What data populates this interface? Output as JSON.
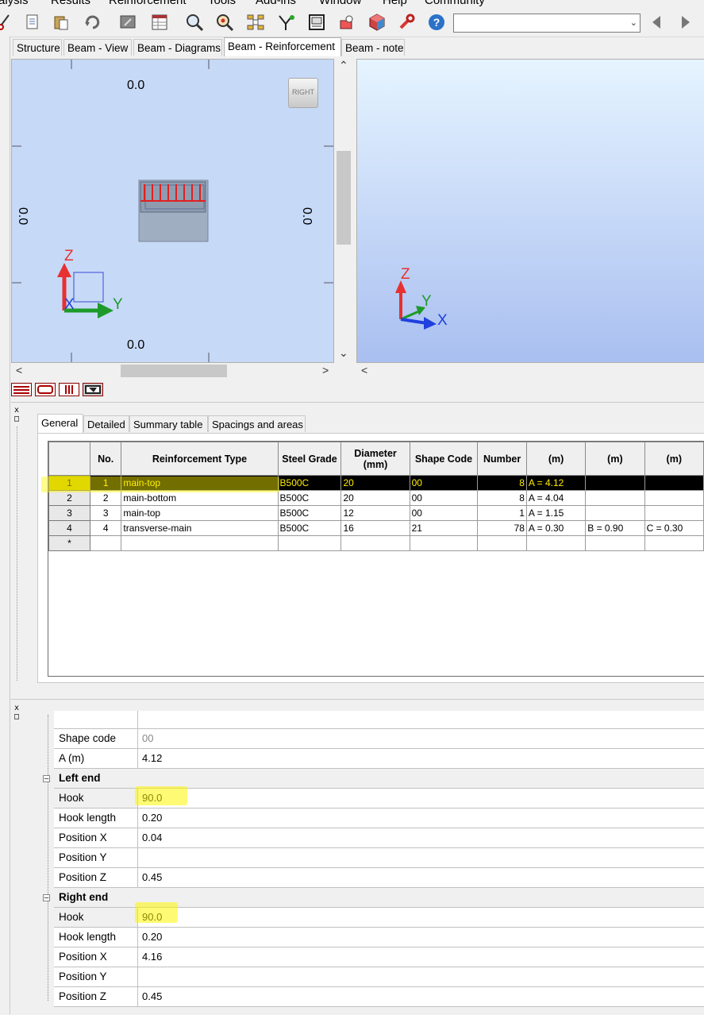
{
  "menu": [
    "alysis",
    "Results",
    "Reinforcement",
    "Tools",
    "Add-ins",
    "Window",
    "Help",
    "Community"
  ],
  "toolbar": {
    "icons": [
      "cut-icon",
      "paste-document-icon",
      "paste-icon",
      "undo-icon",
      "monitor-icon",
      "spreadsheet-icon",
      "zoom-icon",
      "zoom-target-icon",
      "network-icon",
      "tree-icon",
      "table-frame-icon",
      "object-icon",
      "cube-icon",
      "wrench-icon",
      "help-icon"
    ],
    "combo_value": ""
  },
  "tabs": [
    "Structure",
    "Beam - View",
    "Beam - Diagrams",
    "Beam - Reinforcement",
    "Beam - note"
  ],
  "active_tab": "Beam - Reinforcement",
  "viewport_left": {
    "top_value": "0.0",
    "bottom_value": "0.0",
    "left_value": "0.0",
    "right_value": "0.0",
    "view_cube_label": "RIGHT",
    "axes": {
      "z": "Z",
      "y": "Y",
      "x": "X"
    }
  },
  "viewport_right": {
    "axes": {
      "z": "Z",
      "y": "Y",
      "x": "X"
    }
  },
  "sub_tabs": [
    "General",
    "Detailed",
    "Summary table",
    "Spacings and areas"
  ],
  "active_sub_tab": "General",
  "grid": {
    "headers": [
      "No.",
      "Reinforcement Type",
      "Steel Grade",
      "Diameter (mm)",
      "Shape Code",
      "Number",
      "(m)",
      "(m)",
      "(m)"
    ],
    "rows": [
      {
        "row_header": "1",
        "no": "1",
        "type": "main-top",
        "grade": "B500C",
        "diameter": "20",
        "shape": "00",
        "number": "8",
        "m1": "A = 4.12",
        "m2": "",
        "m3": ""
      },
      {
        "row_header": "2",
        "no": "2",
        "type": "main-bottom",
        "grade": "B500C",
        "diameter": "20",
        "shape": "00",
        "number": "8",
        "m1": "A = 4.04",
        "m2": "",
        "m3": ""
      },
      {
        "row_header": "3",
        "no": "3",
        "type": "main-top",
        "grade": "B500C",
        "diameter": "12",
        "shape": "00",
        "number": "1",
        "m1": "A = 1.15",
        "m2": "",
        "m3": ""
      },
      {
        "row_header": "4",
        "no": "4",
        "type": "transverse-main",
        "grade": "B500C",
        "diameter": "16",
        "shape": "21",
        "number": "78",
        "m1": "A = 0.30",
        "m2": "B = 0.90",
        "m3": "C = 0.30"
      }
    ],
    "new_row_marker": "*",
    "selected_row": 1
  },
  "properties": {
    "shape_code_label": "Shape code",
    "shape_code_value": "00",
    "a_label": "A (m)",
    "a_value": "4.12",
    "left_end": {
      "title": "Left end",
      "hook_label": "Hook",
      "hook_value": "90.0",
      "hook_length_label": "Hook length",
      "hook_length_value": "0.20",
      "pos_x_label": "Position X",
      "pos_x_value": "0.04",
      "pos_y_label": "Position Y",
      "pos_y_value": "",
      "pos_z_label": "Position Z",
      "pos_z_value": "0.45"
    },
    "right_end": {
      "title": "Right end",
      "hook_label": "Hook",
      "hook_value": "90.0",
      "hook_length_label": "Hook length",
      "hook_length_value": "0.20",
      "pos_x_label": "Position X",
      "pos_x_value": "4.16",
      "pos_y_label": "Position Y",
      "pos_y_value": "",
      "pos_z_label": "Position Z",
      "pos_z_value": "0.45"
    }
  },
  "colors": {
    "viewport_left_bg": "#c6d9f7",
    "selection_text": "#ffee00",
    "highlight_marker": "#fff500",
    "rebar_red": "#e02020",
    "axis_z": "#e83030",
    "axis_y": "#1e9a2a",
    "axis_x": "#2040e0"
  }
}
